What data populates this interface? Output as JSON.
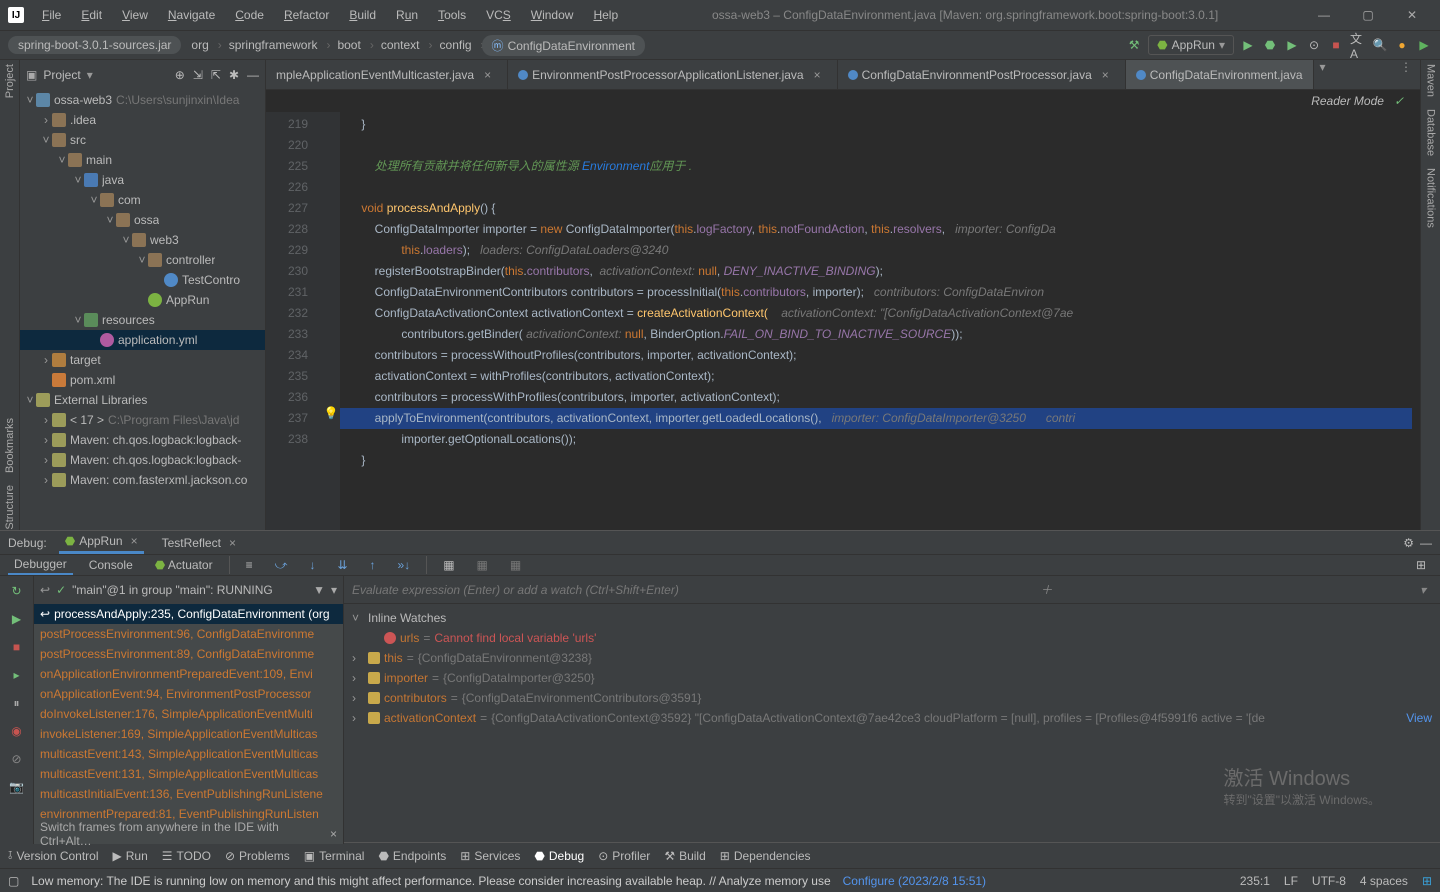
{
  "window": {
    "title": "ossa-web3 – ConfigDataEnvironment.java [Maven: org.springframework.boot:spring-boot:3.0.1]"
  },
  "menu": [
    "File",
    "Edit",
    "View",
    "Navigate",
    "Code",
    "Refactor",
    "Build",
    "Run",
    "Tools",
    "VCS",
    "Window",
    "Help"
  ],
  "breadcrumb": {
    "jar": "spring-boot-3.0.1-sources.jar",
    "segs": [
      "org",
      "springframework",
      "boot",
      "context",
      "config",
      "ConfigDataEnvironment"
    ]
  },
  "run_config": "AppRun",
  "project_panel": {
    "title": "Project",
    "tree": {
      "root": {
        "name": "ossa-web3",
        "hint": "C:\\Users\\sunjinxin\\Idea"
      },
      "idea": ".idea",
      "src": "src",
      "main": "main",
      "java": "java",
      "com": "com",
      "ossa": "ossa",
      "web3": "web3",
      "controller": "controller",
      "test_ctrl": "TestContro",
      "app_run": "AppRun",
      "resources": "resources",
      "app_yml": "application.yml",
      "target": "target",
      "pom": "pom.xml",
      "ext_lib": "External Libraries",
      "jdk": "< 17 >",
      "jdk_hint": "C:\\Program Files\\Java\\jd",
      "m1": "Maven: ch.qos.logback:logback-",
      "m2": "Maven: ch.qos.logback:logback-",
      "m3": "Maven: com.fasterxml.jackson.co"
    }
  },
  "editor_tabs": [
    {
      "label": "mpleApplicationEventMulticaster.java",
      "active": false
    },
    {
      "label": "EnvironmentPostProcessorApplicationListener.java",
      "active": false
    },
    {
      "label": "ConfigDataEnvironmentPostProcessor.java",
      "active": false
    },
    {
      "label": "ConfigDataEnvironment.java",
      "active": true
    }
  ],
  "reader_mode": "Reader Mode",
  "code": {
    "line_start": 219,
    "lines": [
      "219",
      "220",
      "",
      "225",
      "226",
      "227",
      "228",
      "229",
      "230",
      "231",
      "232",
      "233",
      "234",
      "235",
      "236",
      "237",
      "238"
    ],
    "comment_zh": "处理所有贡献并将任何新导入的属性源",
    "comment_env": "Environment",
    "comment_tail": "应用于 .",
    "sig": "processAndApply",
    "l226": "ConfigDataImporter importer",
    "new": "new",
    "l226b": "ConfigDataImporter(",
    "logFactory": "logFactory",
    "nfa": "notFoundAction",
    "resolvers": "resolvers",
    "importer_hint": "importer: ConfigDa",
    "loaders": "loaders",
    "loaders_hint": "loaders: ConfigDataLoaders@3240",
    "rbb": "registerBootstrapBinder(",
    "contributors": "contributors",
    "ac_hint": "activationContext:",
    "null": "null",
    "deny": "DENY_INACTIVE_BINDING",
    "cdec": "ConfigDataEnvironmentContributors contributors = processInitial(",
    "contrib_hint": "contributors: ConfigDataEnviron",
    "cdac": "ConfigDataActivationContext activationContext = ",
    "cac_fn": "createActivationContext(",
    "ac_hint2": "activationContext: \"[ConfigDataActivationContext@7ae",
    "cb": "contributors.getBinder(",
    "bopt": "BinderOption.",
    "fail": "FAIL_ON_BIND_TO_INACTIVE_SOURCE",
    "pwop": "contributors = processWithoutProfiles(contributors, importer, activationContext);",
    "wp": "activationContext = withProfiles(contributors, activationContext);",
    "pwp": "contributors = processWithProfiles(contributors, importer, activationContext);",
    "ate": "applyToEnvironment(contributors, activationContext, importer.getLoadedLocations(),",
    "ate_hint": "importer: ConfigDataImporter@3250      contri",
    "gol": "importer.getOptionalLocations());"
  },
  "debug": {
    "label": "Debug:",
    "tabs": [
      {
        "l": "AppRun"
      },
      {
        "l": "TestReflect"
      }
    ],
    "tool_tabs": [
      "Debugger",
      "Console",
      "Actuator"
    ],
    "thread": "\"main\"@1 in group \"main\": RUNNING",
    "frames": [
      "processAndApply:235, ConfigDataEnvironment (org",
      "postProcessEnvironment:96, ConfigDataEnvironme",
      "postProcessEnvironment:89, ConfigDataEnvironme",
      "onApplicationEnvironmentPreparedEvent:109, Envi",
      "onApplicationEvent:94, EnvironmentPostProcessor",
      "doInvokeListener:176, SimpleApplicationEventMulti",
      "invokeListener:169, SimpleApplicationEventMulticas",
      "multicastEvent:143, SimpleApplicationEventMulticas",
      "multicastEvent:131, SimpleApplicationEventMulticas",
      "multicastInitialEvent:136, EventPublishingRunListene",
      "environmentPrepared:81, EventPublishingRunListen"
    ],
    "frames_hint": "Switch frames from anywhere in the IDE with Ctrl+Alt…",
    "eval_placeholder": "Evaluate expression (Enter) or add a watch (Ctrl+Shift+Enter)",
    "vars": {
      "header": "Inline Watches",
      "urls_name": "urls",
      "urls_err": "Cannot find local variable 'urls'",
      "this_name": "this",
      "this_val": "{ConfigDataEnvironment@3238}",
      "importer_name": "importer",
      "importer_val": "{ConfigDataImporter@3250}",
      "contrib_name": "contributors",
      "contrib_val": "{ConfigDataEnvironmentContributors@3591}",
      "ac_name": "activationContext",
      "ac_val": "{ConfigDataActivationContext@3592} \"[ConfigDataActivationContext@7ae42ce3 cloudPlatform = [null], profiles = [Profiles@4f5991f6 active = '[de",
      "view": "View"
    }
  },
  "bottom_tabs": [
    "Version Control",
    "Run",
    "TODO",
    "Problems",
    "Terminal",
    "Endpoints",
    "Services",
    "Debug",
    "Profiler",
    "Build",
    "Dependencies"
  ],
  "status": {
    "msg": "Low memory: The IDE is running low on memory and this might affect performance. Please consider increasing available heap. // Analyze memory use",
    "cfg": "Configure (2023/2/8 15:51)",
    "pos": "235:1",
    "le": "LF",
    "enc": "UTF-8",
    "indent": "4 spaces"
  },
  "watermark": {
    "t1": "激活 Windows",
    "t2": "转到\"设置\"以激活 Windows。"
  },
  "left_tools": [
    "Project",
    "Bookmarks",
    "Structure"
  ],
  "right_tools": [
    "Maven",
    "Database",
    "Notifications"
  ]
}
